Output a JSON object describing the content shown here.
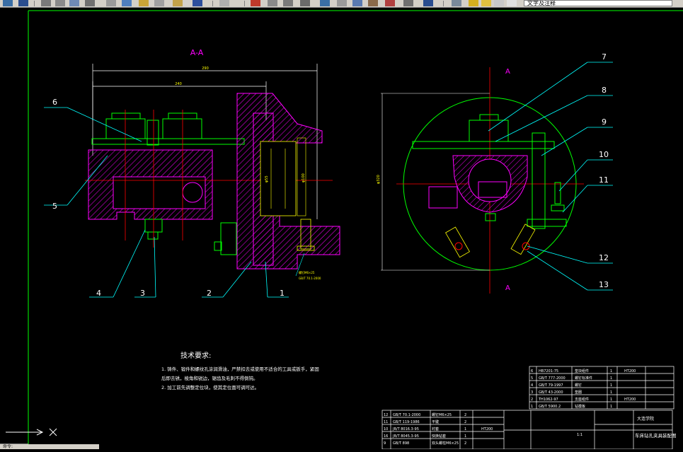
{
  "toolbar": {
    "layer_name": "文字及注释",
    "colors": {
      "bg": "#d4d0c8",
      "dark": "#808080"
    }
  },
  "drawing": {
    "section_label": "A-A",
    "section_mark_left": "A",
    "section_mark_right": "A",
    "dim_overall": "290",
    "dim_inner": "240",
    "dim_diameter_left": "φ55",
    "dim_diameter_right": "φ100",
    "dim_circle": "φ320",
    "balloons_left": [
      "6",
      "5",
      "4",
      "3",
      "2",
      "1"
    ],
    "balloons_right": [
      "7",
      "8",
      "9",
      "10",
      "11",
      "12",
      "13"
    ],
    "note_screw": "螺钉M6×25",
    "note_standard": "GB/T 70.1-2000"
  },
  "tech_req": {
    "title": "技术要求:",
    "line1": "1.  铸件、锻件和螺纹孔涂润滑油，严禁扣去或使用不适合的工具或扳手，紧固",
    "line2": "后即去锈，棱角和锐边，锯齿及毛刺不得倒钝。",
    "line3": "2.  加工前先调整定位块，使其定位面可调可达。"
  },
  "bom_right": [
    {
      "no": "6",
      "code": "HB7201-75",
      "name": "垫块组件",
      "qty": "1",
      "mat": "HT200"
    },
    {
      "no": "5",
      "code": "GB/T 777-2000",
      "name": "螺钉标准件",
      "qty": "1",
      "mat": ""
    },
    {
      "no": "4",
      "code": "GB/T 79-1997",
      "name": "螺钉",
      "qty": "1",
      "mat": ""
    },
    {
      "no": "3",
      "code": "GB/T 43-2000",
      "name": "垫圈",
      "qty": "1",
      "mat": ""
    },
    {
      "no": "2",
      "code": "TH1062-97",
      "name": "支座组件",
      "qty": "1",
      "mat": "HT200"
    },
    {
      "no": "1",
      "code": "GB/T 5900.2",
      "name": "钻模板",
      "qty": "1",
      "mat": ""
    }
  ],
  "bom_bottom": [
    {
      "no": "12",
      "code": "GB/T 70.1-2000",
      "name": "螺钉M6×25",
      "qty": "2",
      "mat": ""
    },
    {
      "no": "11",
      "code": "GB/T 119-1986",
      "name": "平键",
      "qty": "2",
      "mat": ""
    },
    {
      "no": "10",
      "code": "JB/T 8016.3-95",
      "name": "衬套",
      "qty": "1",
      "mat": "HT200"
    },
    {
      "no": "16",
      "code": "JB/T 8045.3-95",
      "name": "快换钻套",
      "qty": "1",
      "mat": ""
    },
    {
      "no": "9",
      "code": "GB/T 898",
      "name": "双头螺柱M6×25",
      "qty": "2",
      "mat": ""
    }
  ],
  "title_block": {
    "company": "大连学院",
    "drawing_name": "车床钻孔夹具装配图",
    "scale": "1:1"
  },
  "cmd_label": "命令:"
}
